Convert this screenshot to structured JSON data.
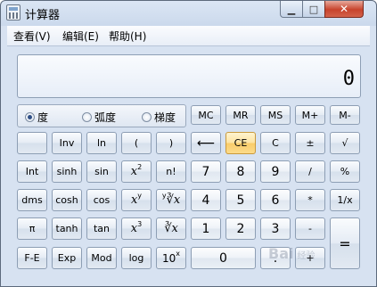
{
  "window": {
    "title": "计算器"
  },
  "window_controls": {
    "minimize": "▁",
    "maximize": "□",
    "close": "✕"
  },
  "menu": [
    "查看(V)",
    "编辑(E)",
    "帮助(H)"
  ],
  "display": {
    "value": "0"
  },
  "angle_modes": [
    {
      "label": "度",
      "checked": true
    },
    {
      "label": "弧度",
      "checked": false
    },
    {
      "label": "梯度",
      "checked": false
    }
  ],
  "memory_buttons": [
    "MC",
    "MR",
    "MS",
    "M+",
    "M-"
  ],
  "keys": {
    "inv": "Inv",
    "ln": "ln",
    "lparen": "(",
    "rparen": ")",
    "backspace": "⟵",
    "ce": "CE",
    "c": "C",
    "plusminus": "±",
    "sqrt": "√",
    "int": "Int",
    "sinh": "sinh",
    "sin": "sin",
    "x": "x",
    "exp2": "2",
    "nfact": "n!",
    "n7": "7",
    "n8": "8",
    "n9": "9",
    "divide": "/",
    "percent": "%",
    "dms": "dms",
    "cosh": "cosh",
    "cos": "cos",
    "expy": "y",
    "root_y": "∛x",
    "root_y_index": "y",
    "n4": "4",
    "n5": "5",
    "n6": "6",
    "multiply": "*",
    "reciprocal": "1/x",
    "pi": "π",
    "tanh": "tanh",
    "tan": "tan",
    "exp3": "3",
    "cbrt": "∛x",
    "n1": "1",
    "n2": "2",
    "n3": "3",
    "minus": "-",
    "equals": "=",
    "fe": "F-E",
    "exp": "Exp",
    "mod": "Mod",
    "log": "log",
    "ten": "10",
    "ten_exp": "x",
    "n0": "0",
    "dot": ".",
    "plus": "+"
  },
  "watermark": {
    "text": "Bai",
    "sub": "经验"
  }
}
